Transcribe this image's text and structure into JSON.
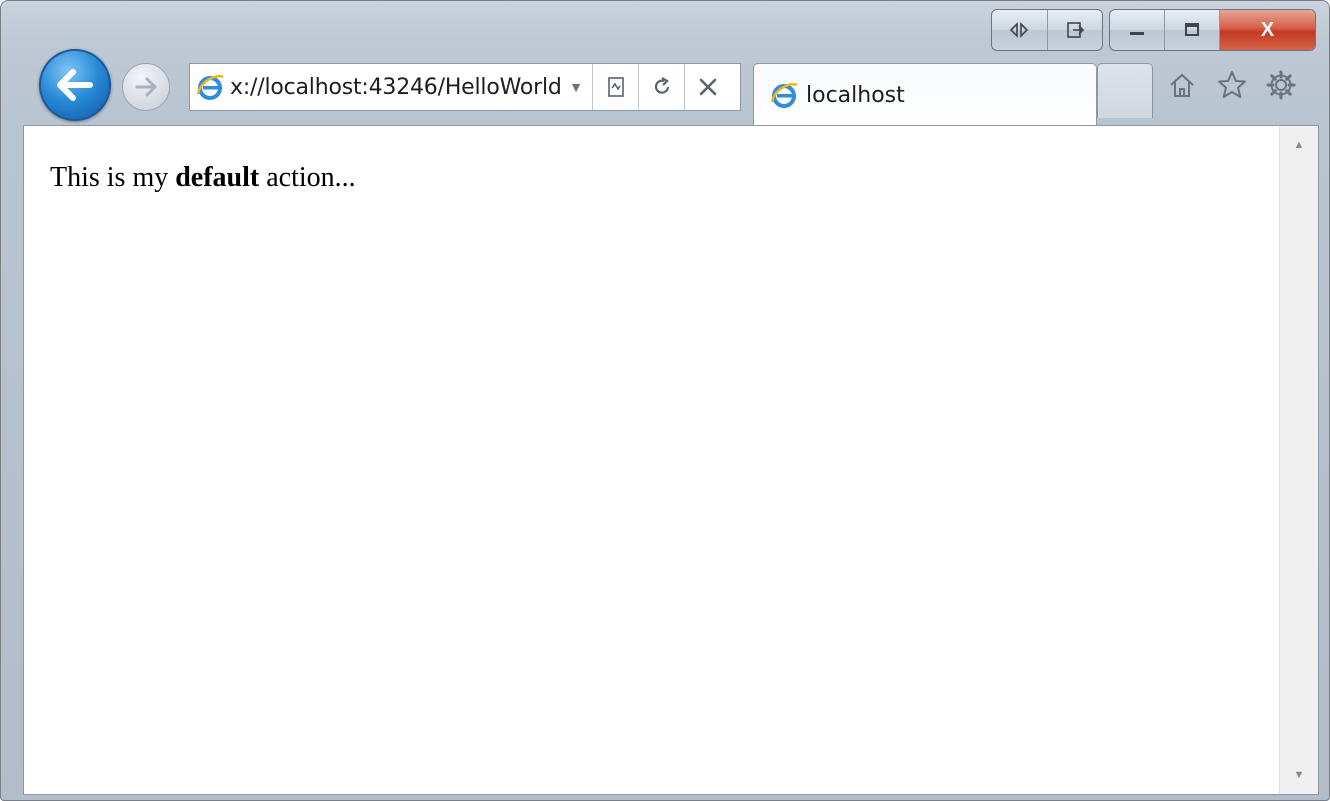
{
  "window": {
    "controls": {
      "minimize": "—",
      "maximize": "☐",
      "close": "X"
    }
  },
  "toolbar": {
    "back_icon": "back-arrow-icon",
    "forward_icon": "forward-arrow-icon",
    "address": {
      "value": "x://localhost:43246/HelloWorld"
    },
    "compat_icon": "compatibility-view-icon",
    "refresh_icon": "refresh-icon",
    "stop_icon": "stop-icon",
    "dropdown_icon": "dropdown-icon"
  },
  "tabs": [
    {
      "label": "localhost",
      "icon": "ie-logo-icon"
    }
  ],
  "tools": [
    "home-icon",
    "favorites-star-icon",
    "tools-gear-icon"
  ],
  "page": {
    "text_before": "This is my ",
    "text_bold": "default",
    "text_after": " action..."
  },
  "colors": {
    "back_button": "#2a8ad6",
    "close_button": "#c23a22",
    "chrome": "#c9d2dd"
  }
}
